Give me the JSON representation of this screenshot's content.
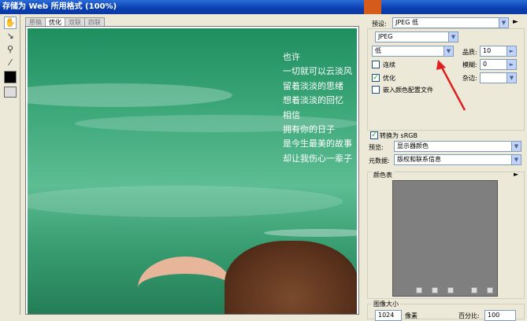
{
  "window": {
    "title": "存储为 Web 所用格式 (100%)"
  },
  "tabs": [
    "原稿",
    "优化",
    "双联",
    "四联"
  ],
  "poem": [
    "也许",
    "一切就可以云淡风",
    "留着淡淡的思绪",
    "想着淡淡的回忆",
    "相信",
    "拥有你的日子",
    "是今生最美的故事",
    "却让我伤心一辈子"
  ],
  "settings": {
    "preset_label": "预设:",
    "preset_value": "JPEG 低",
    "format_value": "JPEG",
    "quality_level": "低",
    "quality_label": "品质:",
    "quality_value": "10",
    "progressive_label": "连续",
    "progressive_checked": false,
    "blur_label": "模糊:",
    "blur_value": "0",
    "optimized_label": "优化",
    "optimized_checked": true,
    "matte_label": "杂边:",
    "matte_value": "",
    "icc_label": "嵌入颜色配置文件",
    "icc_checked": false,
    "srgb_label": "转换为 sRGB",
    "srgb_checked": true,
    "preview_label": "预览:",
    "preview_value": "显示器颜色",
    "metadata_label": "元数据:",
    "metadata_value": "版权和联系信息"
  },
  "color_table": {
    "label": "颜色表"
  },
  "image_size": {
    "label": "图像大小",
    "width_value": "1024",
    "width_unit": "像素",
    "percent_label": "百分比:",
    "percent_value": "100"
  },
  "colors": {
    "title_bar": "#0a3fb0",
    "annotation_arrow": "#e02020",
    "canvas_green": "#3ea97a"
  }
}
